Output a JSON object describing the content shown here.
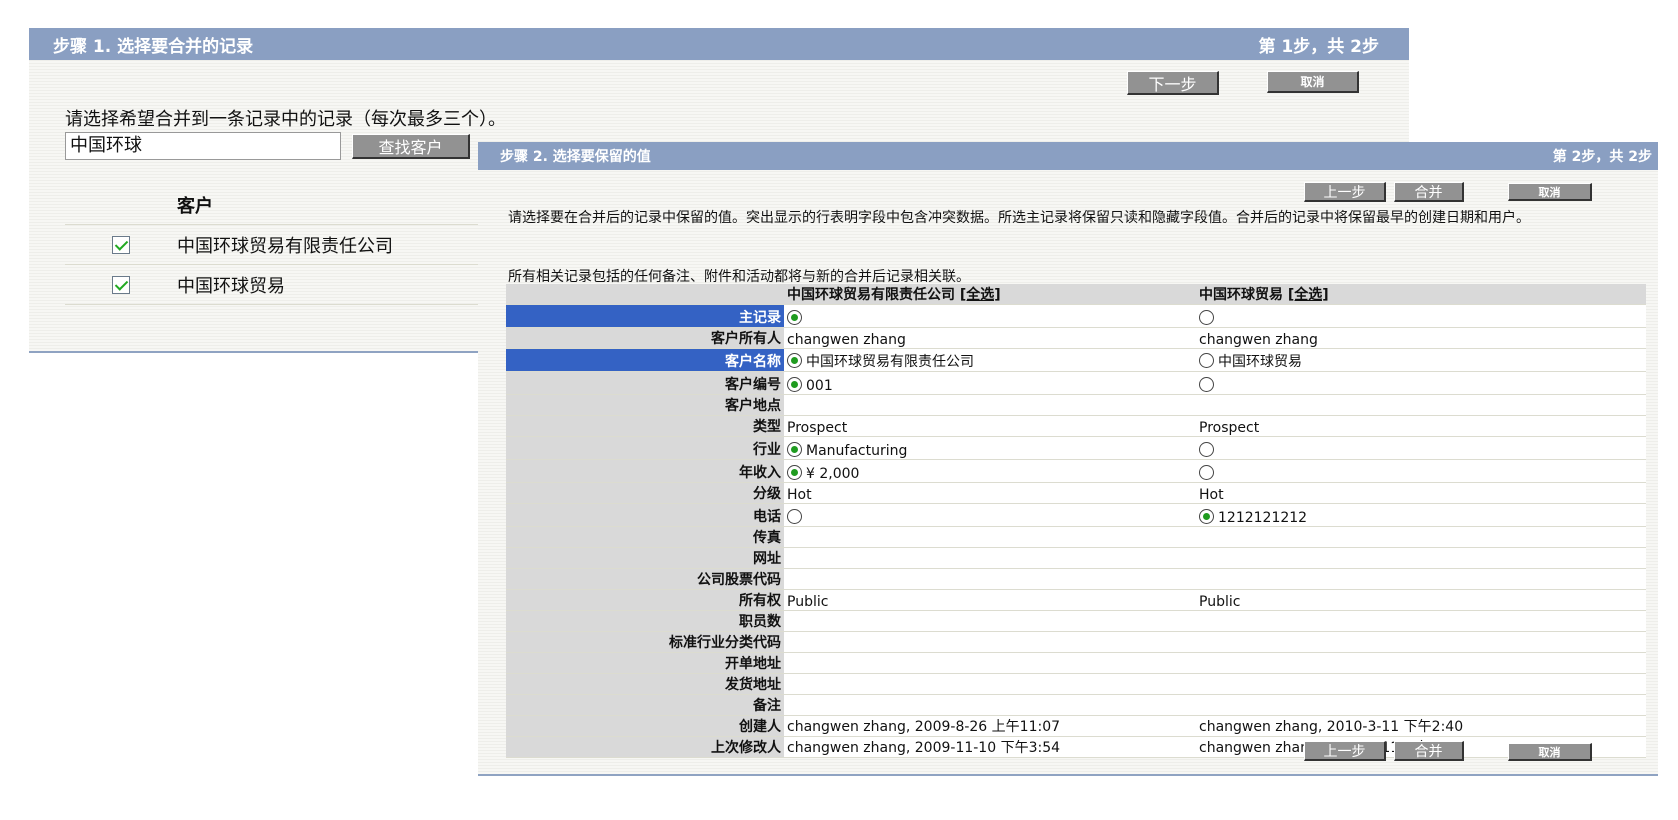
{
  "step1": {
    "title": "步骤 1. 选择要合并的记录",
    "step_indicator": "第 1步，共 2步",
    "next_label": "下一步",
    "cancel_label": "取消",
    "instruction": "请选择希望合并到一条记录中的记录（每次最多三个）。",
    "search_value": "中国环球",
    "search_button": "查找客户",
    "column_header": "客户",
    "results": [
      {
        "name": "中国环球贸易有限责任公司",
        "checked": true
      },
      {
        "name": "中国环球贸易",
        "checked": true
      }
    ]
  },
  "step2": {
    "title": "步骤 2. 选择要保留的值",
    "step_indicator": "第 2步，共 2步",
    "prev_label": "上一步",
    "merge_label": "合并",
    "cancel_label": "取消",
    "instruction": "请选择要在合并后的记录中保留的值。突出显示的行表明字段中包含冲突数据。所选主记录将保留只读和隐藏字段值。合并后的记录中将保留最早的创建日期和用户。",
    "instruction2": "所有相关记录包括的任何备注、附件和活动都将与新的合并后记录相关联。",
    "col1_header": "中国环球贸易有限责任公司",
    "col2_header": "中国环球贸易",
    "select_all": "[全选]",
    "fields": {
      "master": "主记录",
      "owner": "客户所有人",
      "name": "客户名称",
      "number": "客户编号",
      "site": "客户地点",
      "type": "类型",
      "industry": "行业",
      "revenue": "年收入",
      "rating": "分级",
      "phone": "电话",
      "fax": "传真",
      "website": "网址",
      "ticker": "公司股票代码",
      "ownership": "所有权",
      "employees": "职员数",
      "sic": "标准行业分类代码",
      "billing": "开单地址",
      "shipping": "发货地址",
      "notes": "备注",
      "created_by": "创建人",
      "modified_by": "上次修改人"
    },
    "values1": {
      "owner": "changwen zhang",
      "name": "中国环球贸易有限责任公司",
      "number": "001",
      "type": "Prospect",
      "industry": "Manufacturing",
      "revenue": "¥ 2,000",
      "rating": "Hot",
      "ownership": "Public",
      "created_by": "changwen zhang, 2009-8-26 上午11:07",
      "modified_by": "changwen zhang, 2009-11-10 下午3:54"
    },
    "values2": {
      "owner": "changwen zhang",
      "name": "中国环球贸易",
      "type": "Prospect",
      "rating": "Hot",
      "phone": "1212121212",
      "ownership": "Public",
      "created_by": "changwen zhang, 2010-3-11 下午2:40",
      "modified_by": "changwen zhang, 2010-3-11 下午2:40"
    }
  }
}
